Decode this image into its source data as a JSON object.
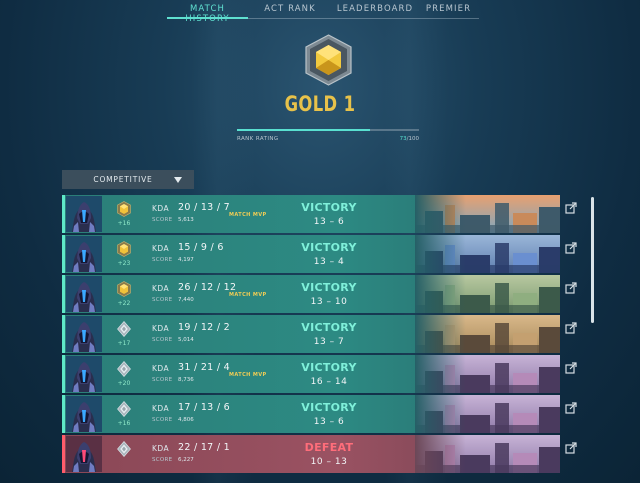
{
  "nav": {
    "tabs": [
      {
        "label": "MATCH HISTORY",
        "active": true
      },
      {
        "label": "ACT RANK",
        "active": false
      },
      {
        "label": "LEADERBOARD",
        "active": false
      },
      {
        "label": "PREMIER",
        "active": false
      }
    ]
  },
  "rank": {
    "title": "GOLD 1",
    "rating_label": "RANK RATING",
    "rating_current": "73",
    "rating_max": "/100",
    "rating_fraction": 0.73
  },
  "filter": {
    "mode": "COMPETITIVE"
  },
  "colors": {
    "accent": "#5fe0d0",
    "gold": "#e8c24a",
    "victory": "#7ff0da",
    "defeat": "#ff6d7a"
  },
  "matches": [
    {
      "result": "VICTORY",
      "outcome": "win",
      "kda": "20 / 13 / 7",
      "score_label": "SCORE",
      "score": "5,613",
      "rr": "+16",
      "mvp": "MATCH MVP",
      "rank_icon": "gold",
      "rounds": "13 – 6",
      "map_theme": "sunset"
    },
    {
      "result": "VICTORY",
      "outcome": "win",
      "kda": "15 / 9 / 6",
      "score_label": "SCORE",
      "score": "4,197",
      "rr": "+23",
      "mvp": "",
      "rank_icon": "gold",
      "rounds": "13 – 4",
      "map_theme": "blue"
    },
    {
      "result": "VICTORY",
      "outcome": "win",
      "kda": "26 / 12 / 12",
      "score_label": "SCORE",
      "score": "7,440",
      "rr": "+22",
      "mvp": "MATCH MVP",
      "rank_icon": "gold",
      "rounds": "13 – 10",
      "map_theme": "green"
    },
    {
      "result": "VICTORY",
      "outcome": "win",
      "kda": "19 / 12 / 2",
      "score_label": "SCORE",
      "score": "5,014",
      "rr": "+17",
      "mvp": "",
      "rank_icon": "silver",
      "rounds": "13 – 7",
      "map_theme": "desert"
    },
    {
      "result": "VICTORY",
      "outcome": "win",
      "kda": "31 / 21 / 4",
      "score_label": "SCORE",
      "score": "8,736",
      "rr": "+20",
      "mvp": "MATCH MVP",
      "rank_icon": "silver",
      "rounds": "16 – 14",
      "map_theme": "purple"
    },
    {
      "result": "VICTORY",
      "outcome": "win",
      "kda": "17 / 13 / 6",
      "score_label": "SCORE",
      "score": "4,806",
      "rr": "+16",
      "mvp": "",
      "rank_icon": "silver",
      "rounds": "13 – 6",
      "map_theme": "purple"
    },
    {
      "result": "DEFEAT",
      "outcome": "loss",
      "kda": "22 / 17 / 1",
      "score_label": "SCORE",
      "score": "6,227",
      "rr": "",
      "mvp": "",
      "rank_icon": "silver",
      "rounds": "10 – 13",
      "map_theme": "purple"
    }
  ]
}
